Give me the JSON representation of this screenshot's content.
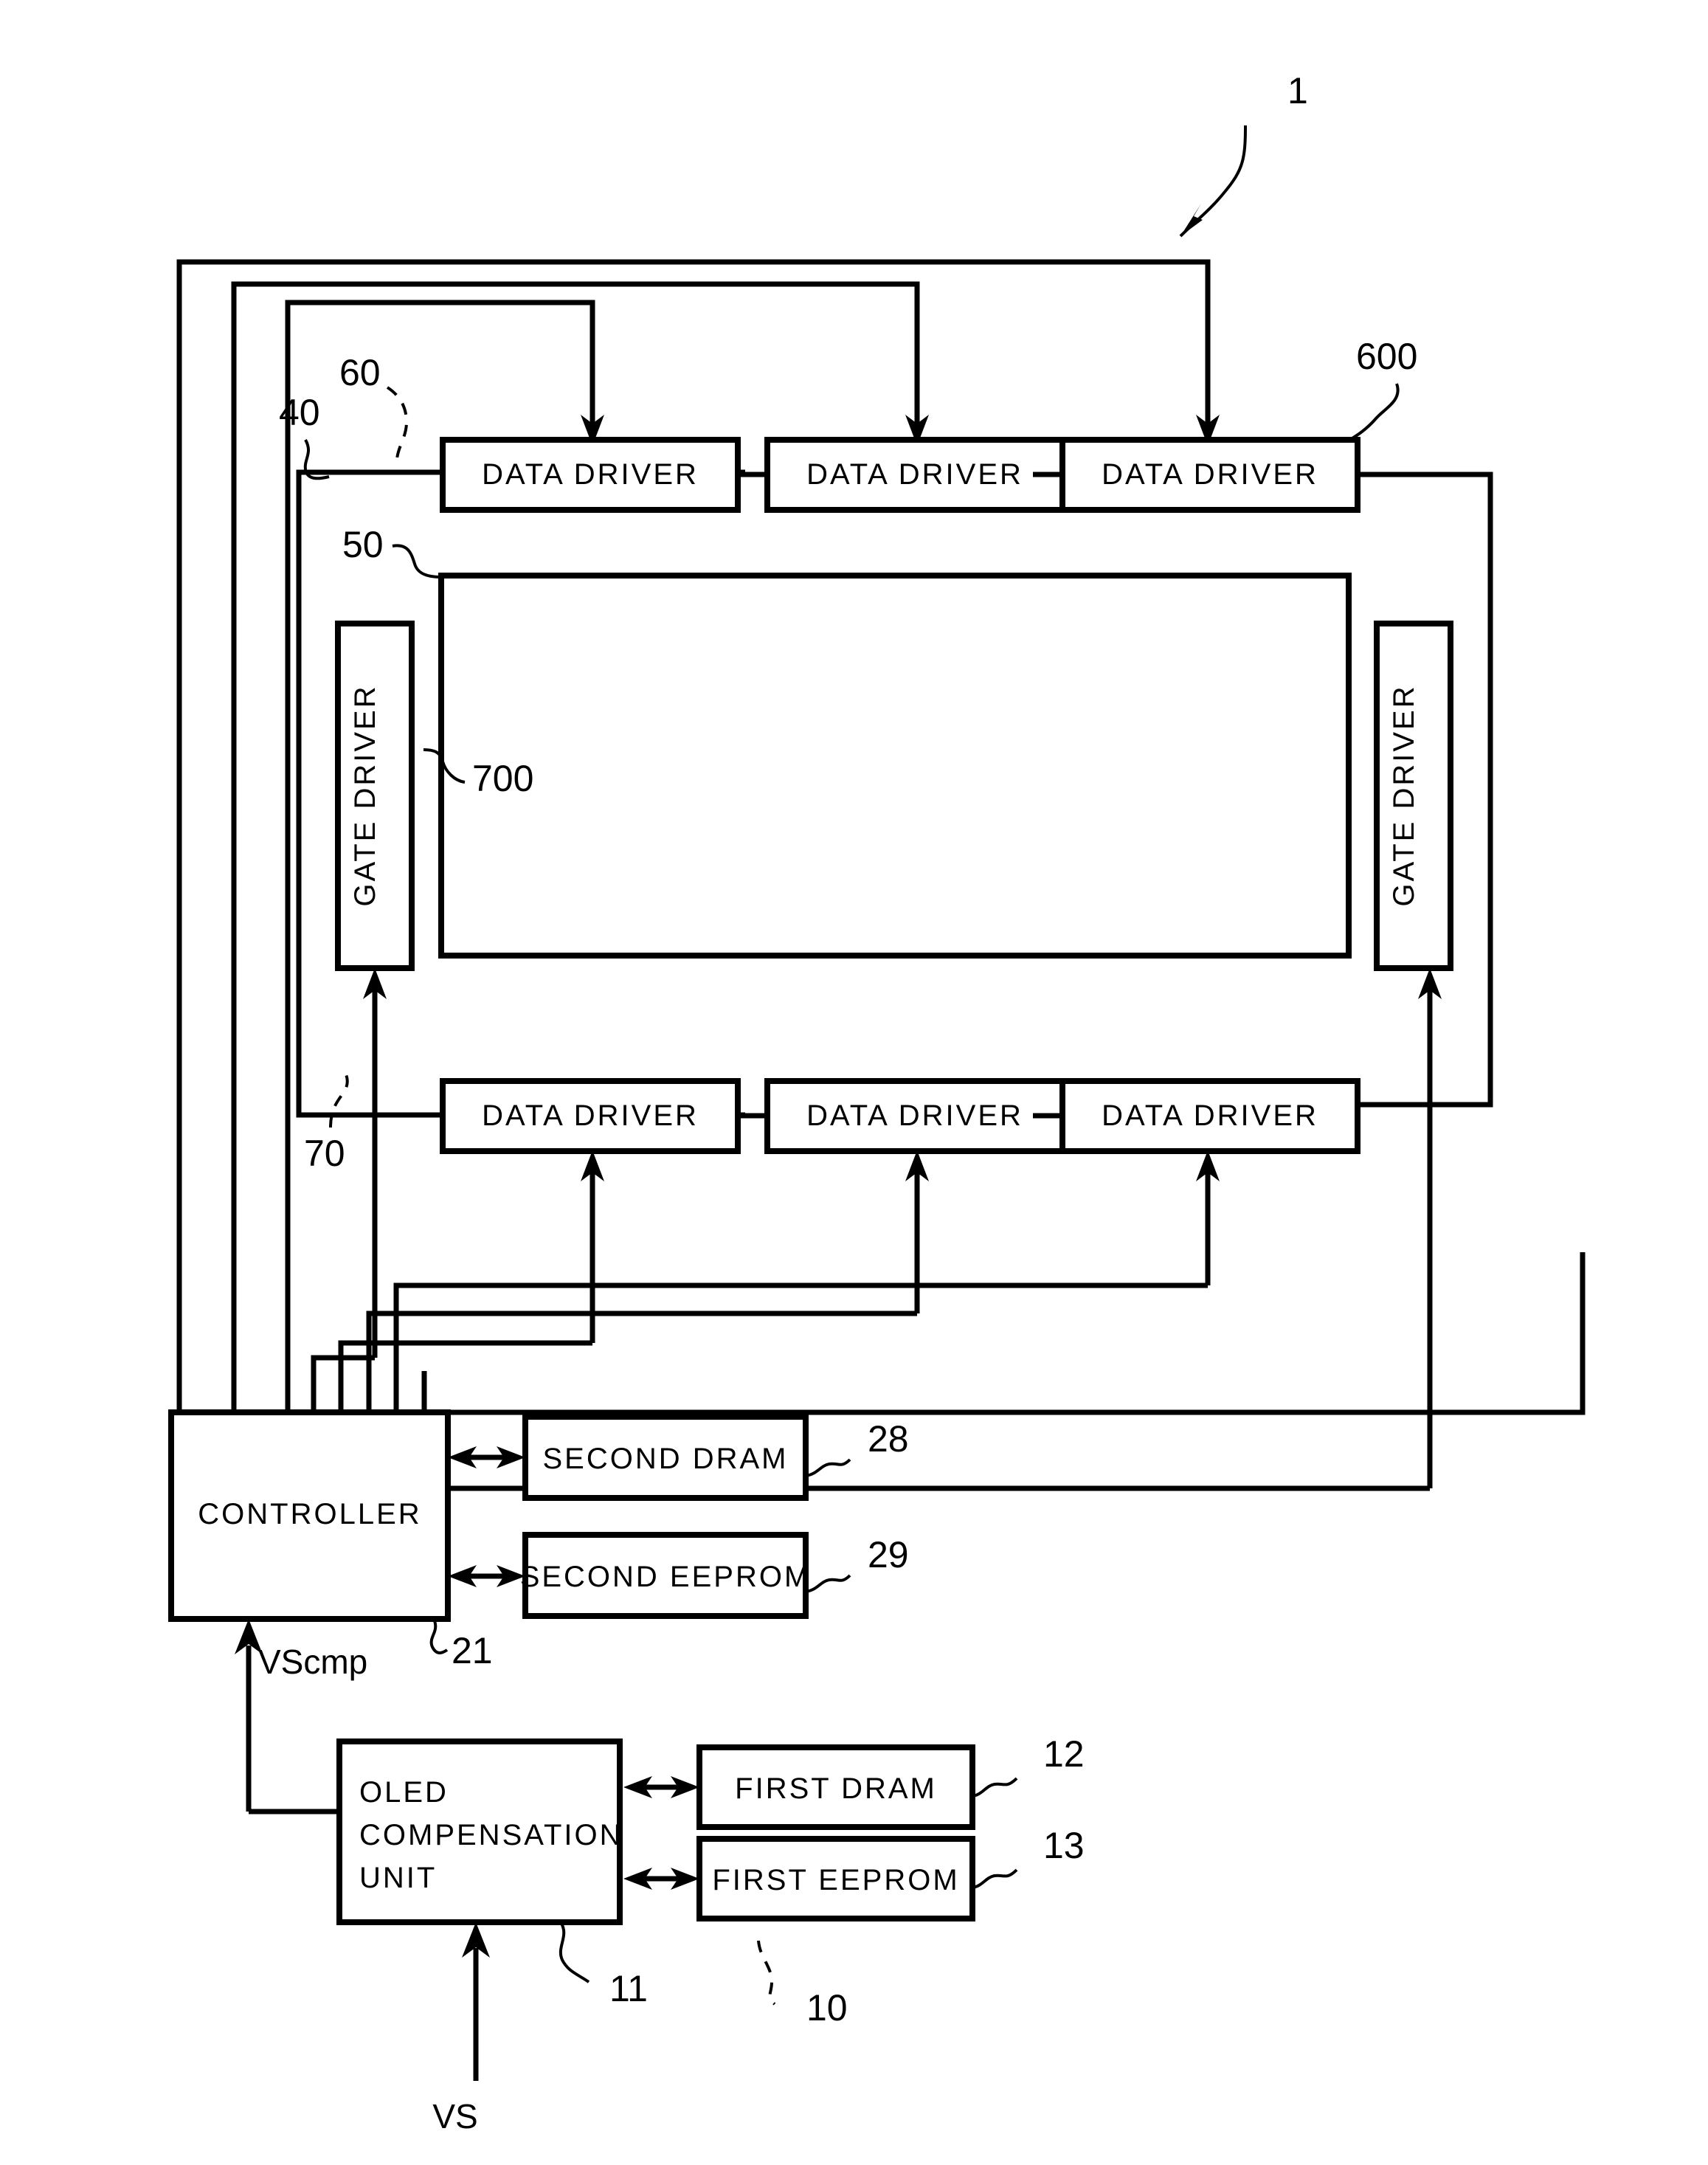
{
  "figure": {
    "title_ref": "1",
    "type": "patent-block-diagram"
  },
  "reference_numerals": {
    "device": "1",
    "panel_assembly": "600",
    "display_panel": "700",
    "data_driver_group": "60",
    "gate_driver_group": "50",
    "outer_frame_40": "40",
    "lower_frame_70": "70",
    "controller": "21",
    "second_dram": "28",
    "second_eeprom": "29",
    "oled_compensation_unit": "11",
    "first_dram": "12",
    "first_eeprom": "13",
    "compensation_block": "10"
  },
  "blocks": {
    "data_drivers_top": [
      {
        "label": "DATA DRIVER"
      },
      {
        "label": "DATA DRIVER"
      },
      {
        "label": "DATA DRIVER"
      }
    ],
    "data_drivers_bottom": [
      {
        "label": "DATA DRIVER"
      },
      {
        "label": "DATA DRIVER"
      },
      {
        "label": "DATA DRIVER"
      }
    ],
    "gate_driver_left": {
      "label": "GATE DRIVER"
    },
    "gate_driver_right": {
      "label": "GATE DRIVER"
    },
    "controller": {
      "label": "CONTROLLER"
    },
    "second_dram": {
      "label": "SECOND DRAM"
    },
    "second_eeprom": {
      "label": "SECOND EEPROM"
    },
    "oled_compensation_unit": {
      "line1": "OLED",
      "line2": "COMPENSATION",
      "line3": "UNIT"
    },
    "first_dram": {
      "label": "FIRST DRAM"
    },
    "first_eeprom": {
      "label": "FIRST EEPROM"
    }
  },
  "signals": {
    "vscmp": "VScmp",
    "vs": "VS"
  },
  "colors": {
    "stroke": "#000000",
    "background": "#ffffff"
  }
}
